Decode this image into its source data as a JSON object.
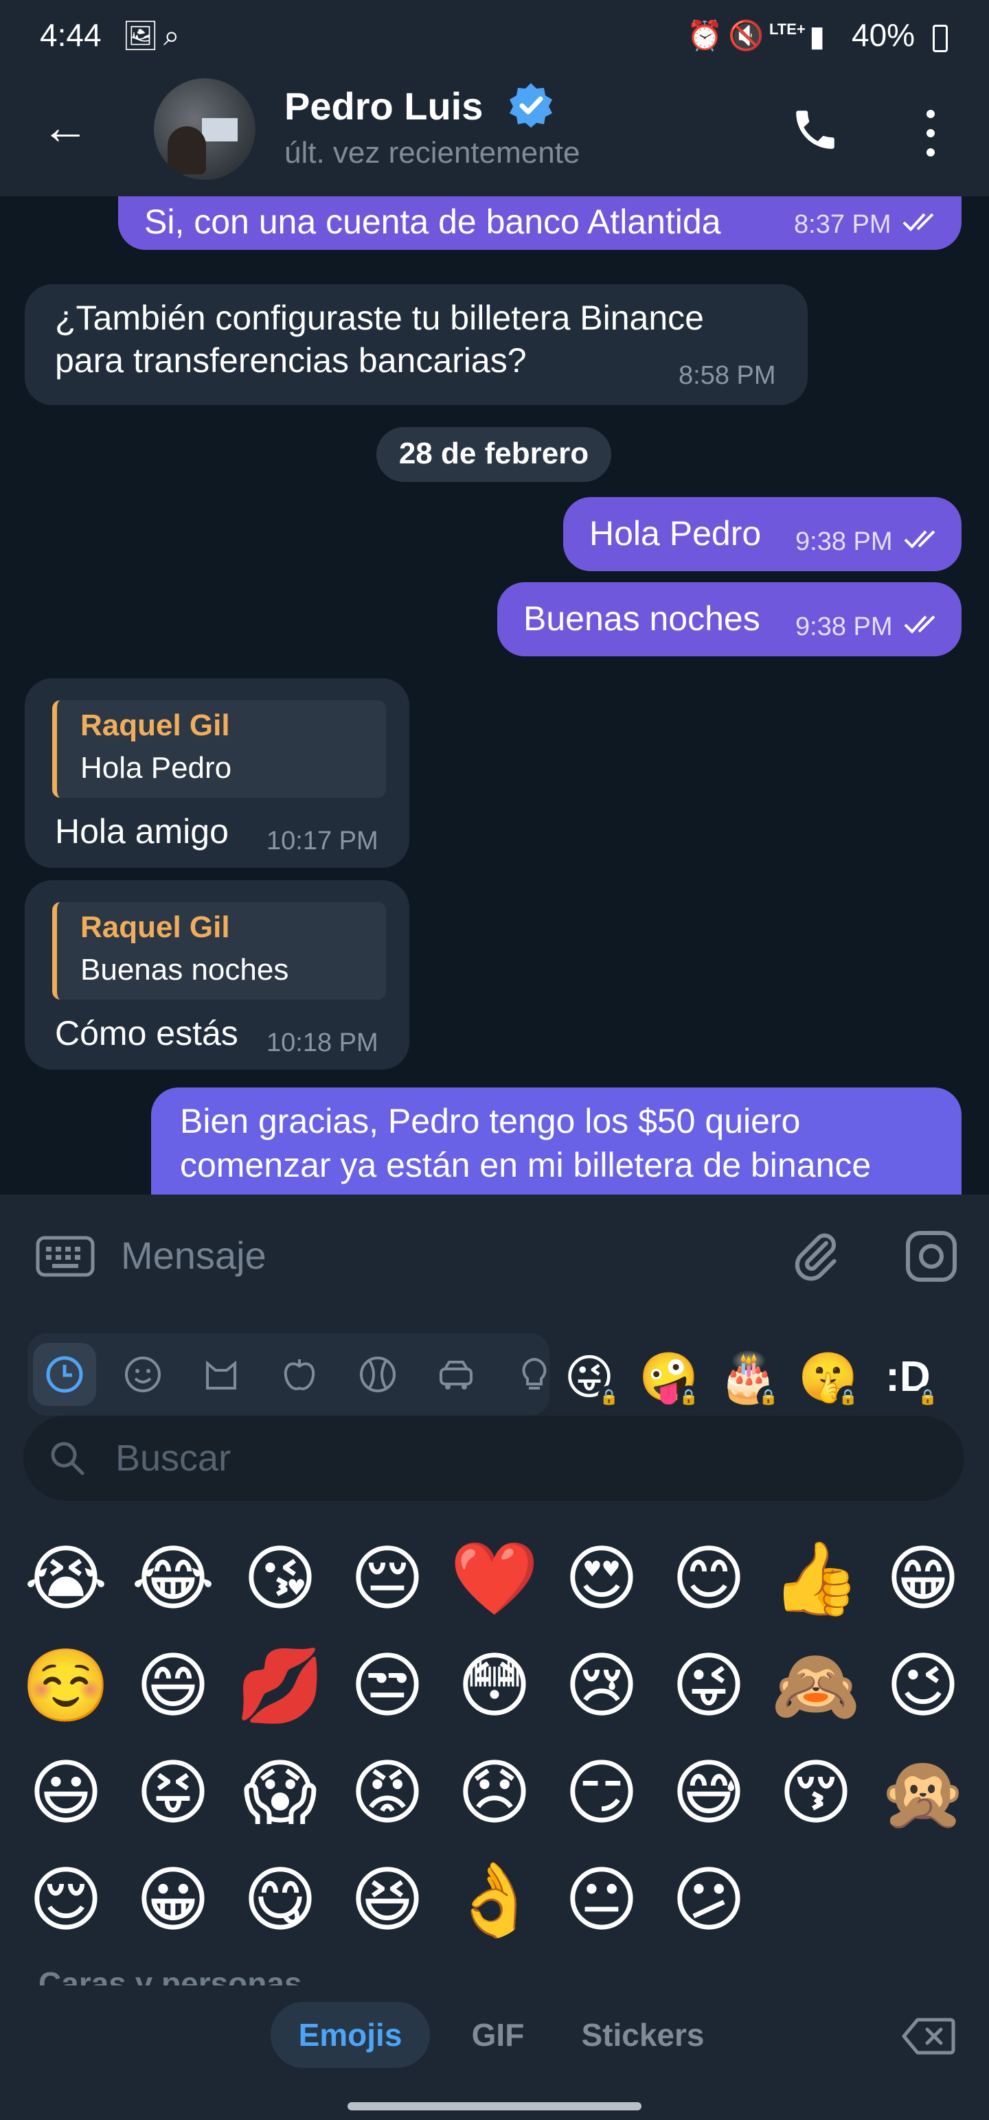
{
  "status_bar": {
    "time": "4:44",
    "network": "LTE+",
    "battery": "40%"
  },
  "header": {
    "contact_name": "Pedro Luis",
    "last_seen": "últ. vez recientemente"
  },
  "messages": [
    {
      "direction": "out",
      "text": "Si, con una cuenta de banco Atlantida",
      "time": "8:37 PM",
      "read": true
    },
    {
      "direction": "in",
      "text_lines": [
        "¿También configuraste tu billetera Binance",
        "para transferencias bancarias?"
      ],
      "time": "8:58 PM"
    },
    {
      "type": "date",
      "text": "28 de febrero"
    },
    {
      "direction": "out",
      "text": "Hola Pedro",
      "time": "9:38 PM",
      "read": true
    },
    {
      "direction": "out",
      "text": "Buenas noches",
      "time": "9:38 PM",
      "read": true
    },
    {
      "direction": "in",
      "reply_to": {
        "name": "Raquel Gil",
        "text": "Hola Pedro"
      },
      "text": "Hola amigo",
      "time": "10:17 PM"
    },
    {
      "direction": "in",
      "reply_to": {
        "name": "Raquel Gil",
        "text": "Buenas noches"
      },
      "text": "Cómo estás",
      "time": "10:18 PM"
    },
    {
      "direction": "out",
      "text_lines": [
        "Bien gracias, Pedro tengo los $50 quiero",
        "comenzar ya están en mi billetera de binance"
      ]
    }
  ],
  "input": {
    "placeholder": "Mensaje"
  },
  "emoji_panel": {
    "categories": [
      "recent-icon",
      "smileys-icon",
      "animals-icon",
      "food-icon",
      "activity-icon",
      "travel-icon",
      "objects-icon"
    ],
    "locked_sets": [
      "😜",
      "🤪",
      "🎂",
      "🤫",
      ":D"
    ],
    "search_placeholder": "Buscar",
    "emojis": [
      [
        "😭",
        "😂",
        "😘",
        "😔",
        "❤️",
        "😍",
        "😊",
        "👍",
        "😁"
      ],
      [
        "☺️",
        "😄",
        "💋",
        "😒",
        "😳",
        "😢",
        "😜",
        "🙈",
        "😉"
      ],
      [
        "😃",
        "😝",
        "😱",
        "😡",
        "😞",
        "😏",
        "😅",
        "😚",
        "🙊"
      ],
      [
        "😌",
        "😀",
        "😋",
        "😆",
        "👌",
        "😐",
        "😕"
      ]
    ],
    "section_label": "Caras y personas",
    "tabs": [
      "Emojis",
      "GIF",
      "Stickers"
    ],
    "active_tab": "Emojis"
  },
  "colors": {
    "outgoing_bubble": "#7058dc",
    "incoming_bubble": "#212d3b",
    "reply_accent": "#f0ad5a",
    "active_tab": "#4ea4f5"
  }
}
